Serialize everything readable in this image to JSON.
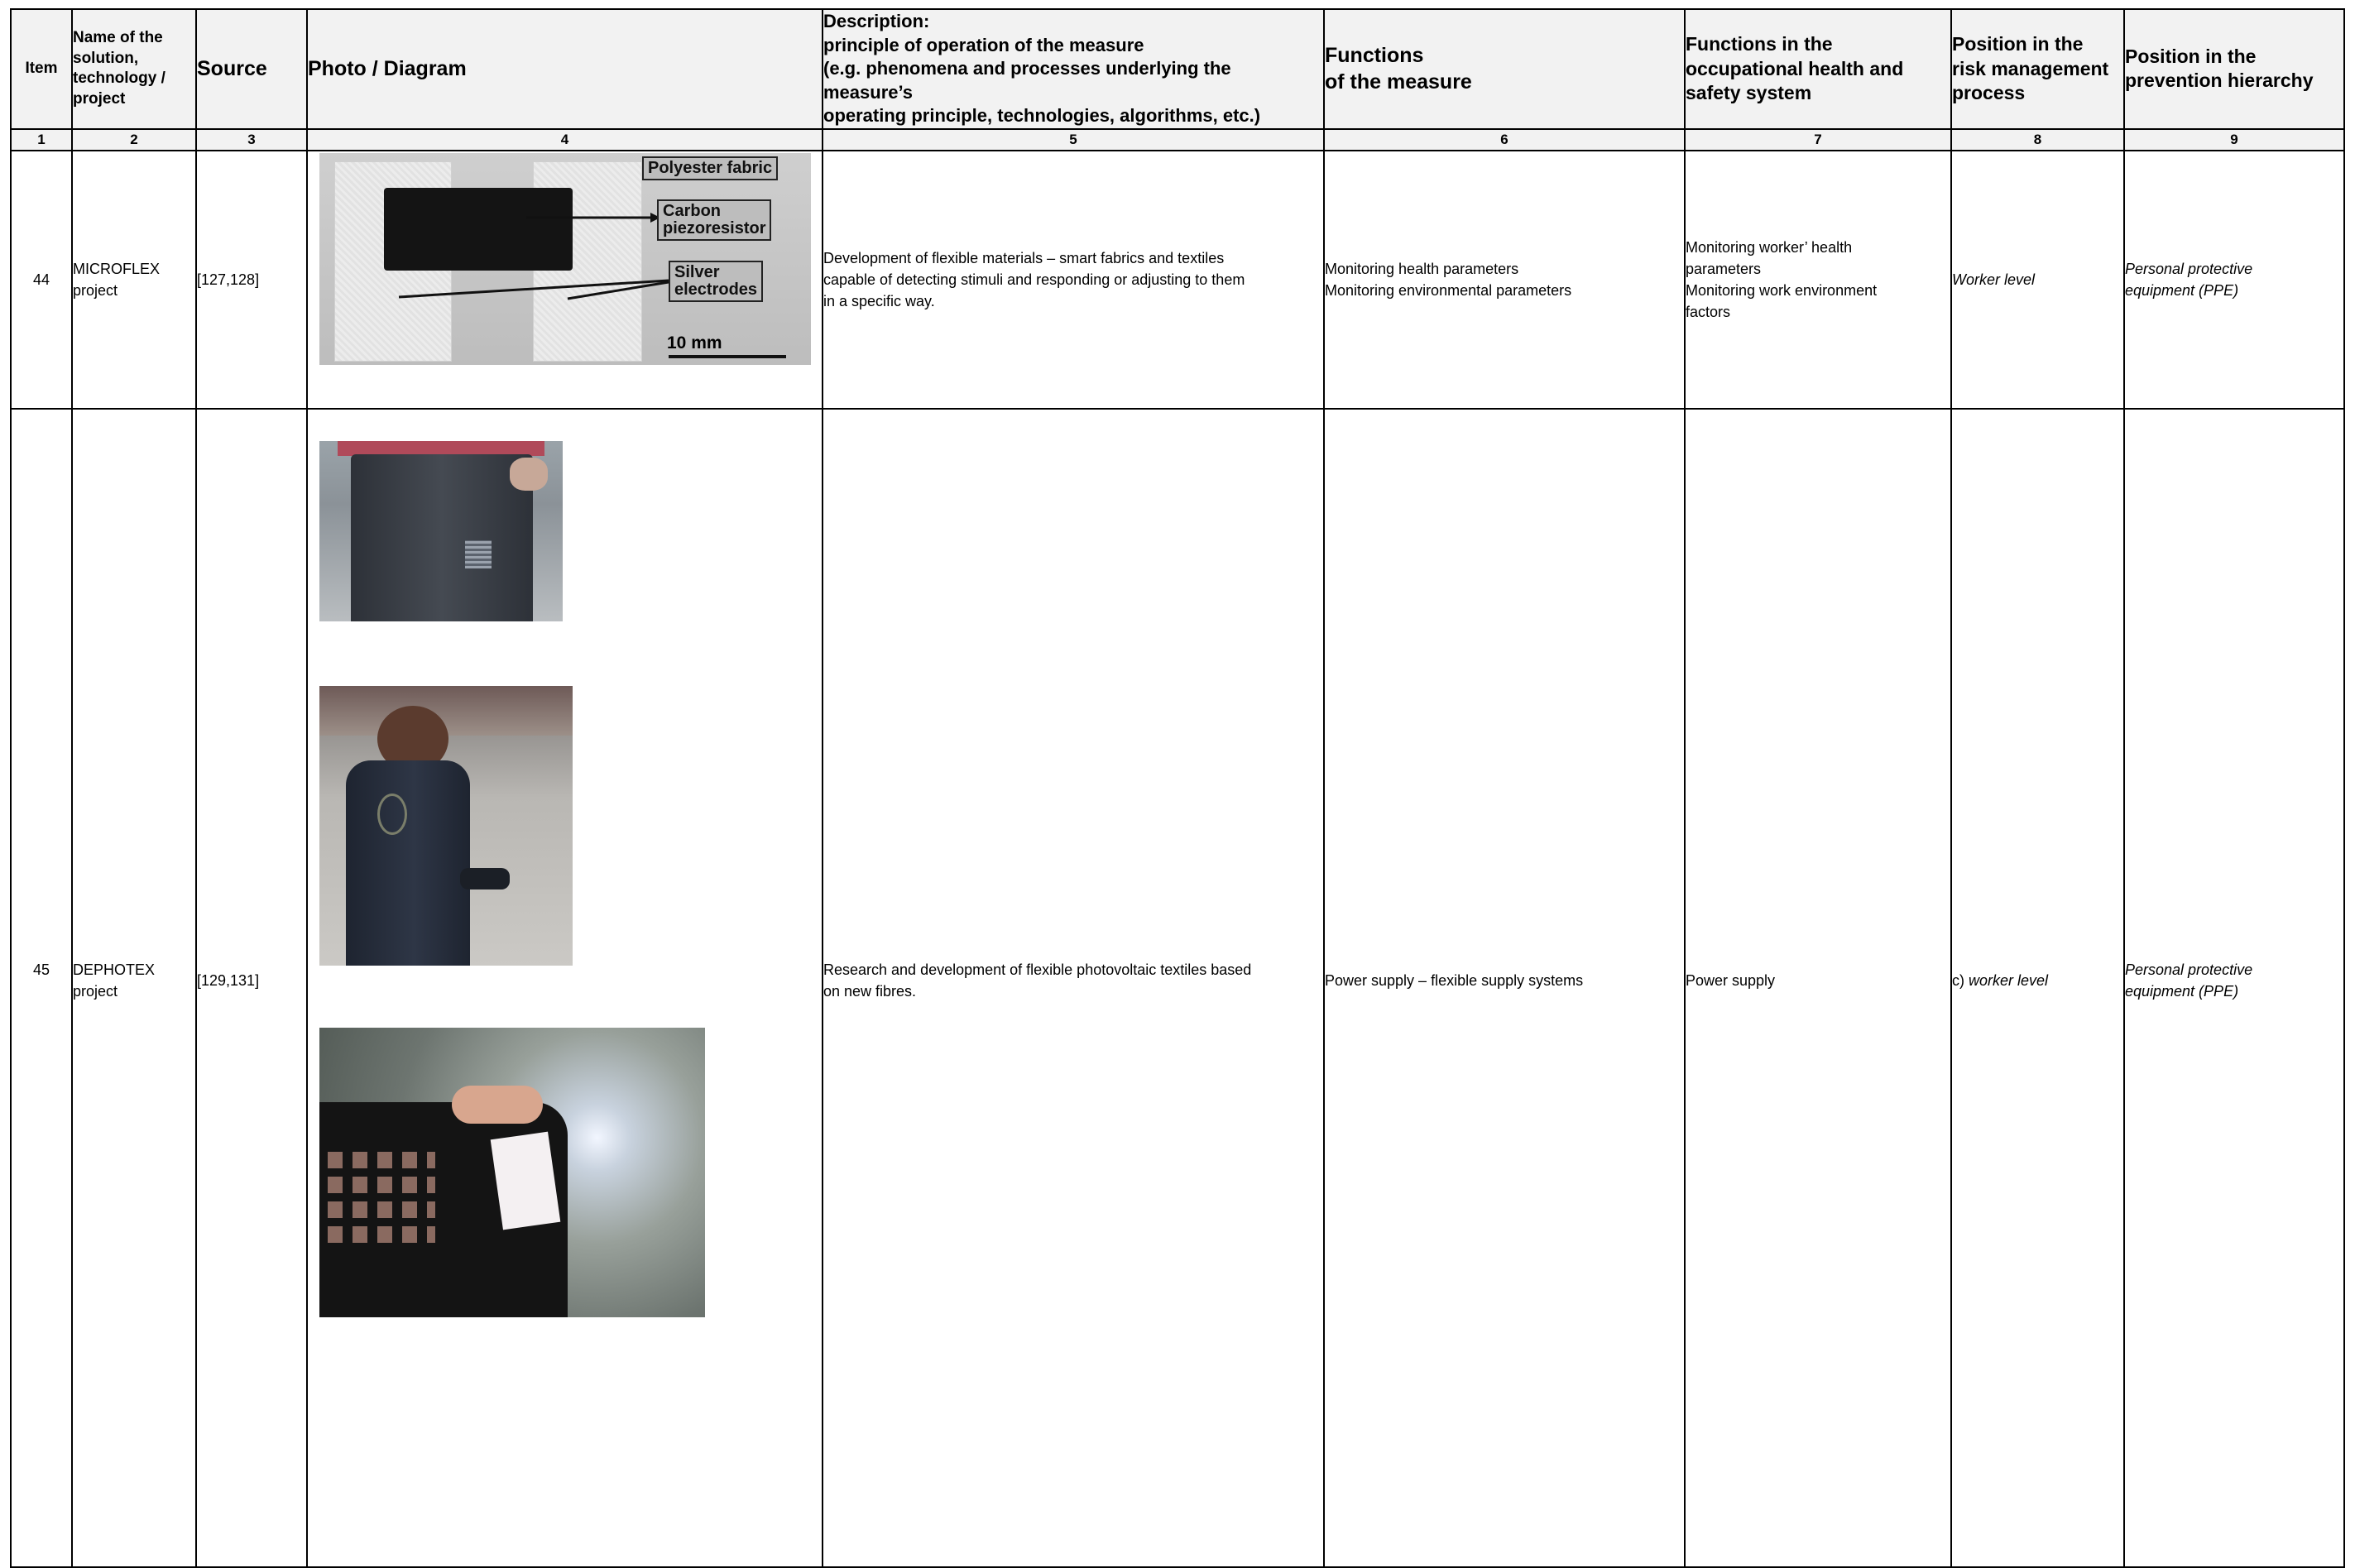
{
  "header": {
    "item": "Item",
    "name": [
      "Name of the",
      "solution,",
      "technology /",
      "project"
    ],
    "source": "Source",
    "photo": "Photo / Diagram",
    "description": [
      "Description:",
      "principle of operation of the measure",
      "(e.g. phenomena and processes underlying the measure’s",
      "operating principle, technologies, algorithms, etc.)"
    ],
    "functions": [
      "Functions",
      "of the measure"
    ],
    "functions_ohs": [
      "Functions in the",
      "occupational health and",
      "safety system"
    ],
    "position_risk": [
      "Position in the",
      "risk management",
      "process"
    ],
    "position_prevention": [
      "Position in the",
      "prevention hierarchy"
    ]
  },
  "column_numbers": [
    "1",
    "2",
    "3",
    "4",
    "5",
    "6",
    "7",
    "8",
    "9"
  ],
  "rows": [
    {
      "item": "44",
      "name": [
        "MICROFLEX",
        "project"
      ],
      "source": "[127,128]",
      "figure": {
        "labels": [
          "Polyester fabric",
          "Carbon",
          "piezoresistor",
          "Silver",
          "electrodes"
        ],
        "scale": "10 mm"
      },
      "description": [
        "Development of flexible materials – smart fabrics and textiles",
        "capable of detecting stimuli and responding or adjusting to them",
        "in a specific way."
      ],
      "functions": [
        "Monitoring health parameters",
        "Monitoring environmental parameters"
      ],
      "functions_ohs": [
        "Monitoring worker’ health",
        "parameters",
        "Monitoring work environment",
        "factors"
      ],
      "position_risk": "Worker level",
      "position_prevention": [
        "Personal protective",
        "equipment (PPE)"
      ]
    },
    {
      "item": "45",
      "name": [
        "DEPHOTEX",
        "project"
      ],
      "source": "[129,131]",
      "description": [
        "Research and development of flexible photovoltaic textiles based",
        "on new fibres."
      ],
      "functions": [
        "Power supply – flexible supply systems"
      ],
      "functions_ohs": [
        "Power supply"
      ],
      "position_risk_prefix": "c)",
      "position_risk": "worker level",
      "position_prevention": [
        "Personal protective",
        "equipment (PPE)"
      ]
    }
  ]
}
